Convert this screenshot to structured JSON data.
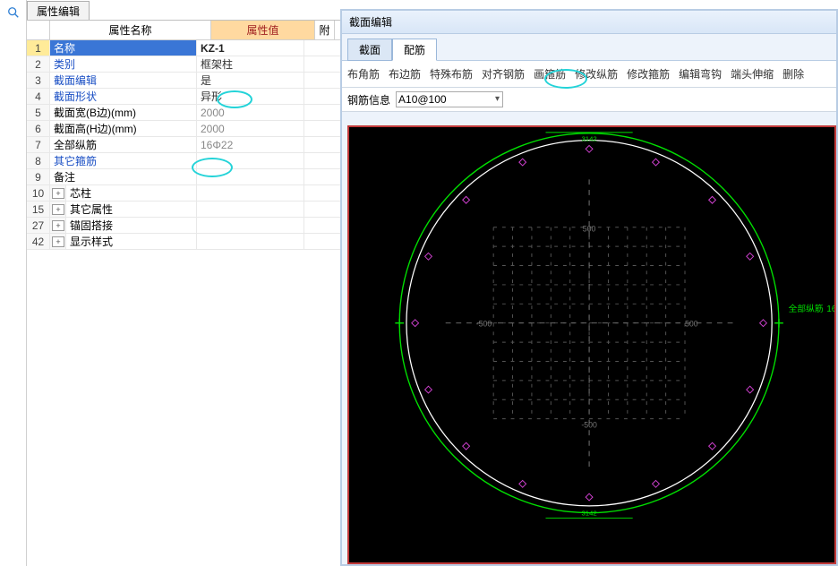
{
  "left": {
    "tab": "属性编辑",
    "header": {
      "name": "属性名称",
      "value": "属性值",
      "extra": "附"
    },
    "rows": [
      {
        "n": "1",
        "name": "名称",
        "val": "KZ-1",
        "link": true,
        "sel": true
      },
      {
        "n": "2",
        "name": "类别",
        "val": "框架柱",
        "link": true
      },
      {
        "n": "3",
        "name": "截面编辑",
        "val": "是",
        "link": true
      },
      {
        "n": "4",
        "name": "截面形状",
        "val": "异形",
        "link": true
      },
      {
        "n": "5",
        "name": "截面宽(B边)(mm)",
        "val": "2000"
      },
      {
        "n": "6",
        "name": "截面高(H边)(mm)",
        "val": "2000"
      },
      {
        "n": "7",
        "name": "全部纵筋",
        "val": "16Φ22"
      },
      {
        "n": "8",
        "name": "其它箍筋",
        "val": "",
        "link": true
      },
      {
        "n": "9",
        "name": "备注",
        "val": ""
      },
      {
        "n": "10",
        "name": "芯柱",
        "val": "",
        "group": true
      },
      {
        "n": "15",
        "name": "其它属性",
        "val": "",
        "group": true
      },
      {
        "n": "27",
        "name": "锚固搭接",
        "val": "",
        "group": true
      },
      {
        "n": "42",
        "name": "显示样式",
        "val": "",
        "group": true
      }
    ]
  },
  "right": {
    "title": "截面编辑",
    "tabs": [
      "截面",
      "配筋"
    ],
    "active_tab": "配筋",
    "toolbar": [
      "布角筋",
      "布边筋",
      "特殊布筋",
      "对齐钢筋",
      "画箍筋",
      "修改纵筋",
      "修改箍筋",
      "编辑弯钩",
      "端头伸缩",
      "删除"
    ],
    "info_label": "钢筋信息",
    "info_value": "A10@100",
    "dim_label": "3142",
    "grid_labels": [
      "500",
      "500",
      "-500",
      "-500"
    ],
    "side_label": "全部纵筋",
    "side_value": "16"
  }
}
